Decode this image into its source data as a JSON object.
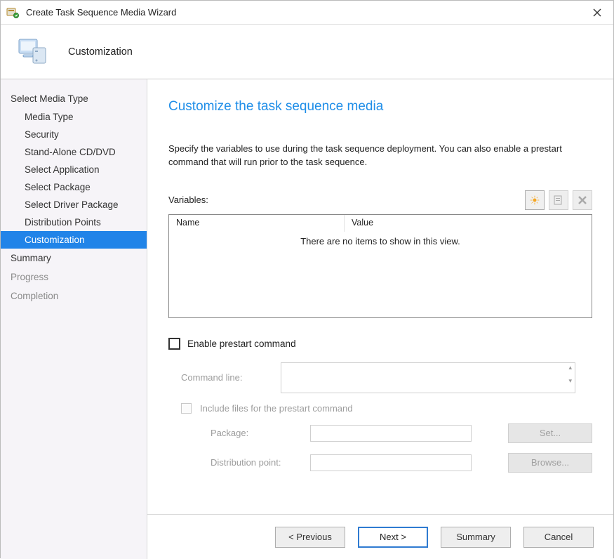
{
  "window": {
    "title": "Create Task Sequence Media Wizard"
  },
  "header": {
    "step_title": "Customization"
  },
  "sidebar": {
    "group1": "Select Media Type",
    "items": [
      "Media Type",
      "Security",
      "Stand-Alone CD/DVD",
      "Select Application",
      "Select Package",
      "Select Driver Package",
      "Distribution Points",
      "Customization"
    ],
    "summary": "Summary",
    "progress": "Progress",
    "completion": "Completion",
    "selected_index": 7
  },
  "main": {
    "heading": "Customize the task sequence media",
    "description": "Specify the variables to use during the task sequence deployment. You can also enable a prestart command that will run prior to the task sequence.",
    "variables_label": "Variables:",
    "columns": {
      "name": "Name",
      "value": "Value"
    },
    "empty_message": "There are no items to show in this view.",
    "enable_prestart_label": "Enable prestart command",
    "cmdline_label": "Command line:",
    "include_files_label": "Include files for the prestart command",
    "package_label": "Package:",
    "distpoint_label": "Distribution point:",
    "set_btn": "Set...",
    "browse_btn": "Browse..."
  },
  "footer": {
    "previous": "< Previous",
    "next": "Next >",
    "summary": "Summary",
    "cancel": "Cancel"
  }
}
